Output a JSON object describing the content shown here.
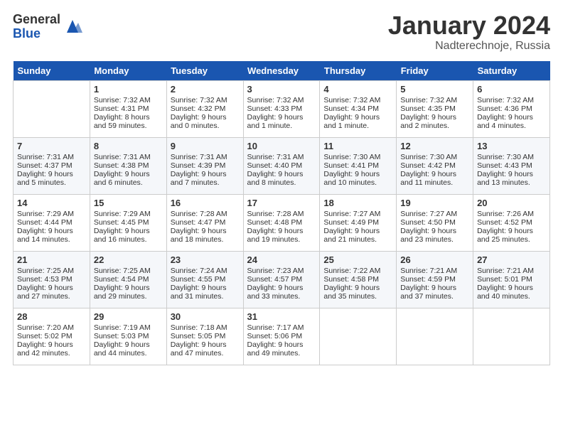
{
  "logo": {
    "general": "General",
    "blue": "Blue"
  },
  "title": "January 2024",
  "subtitle": "Nadterechnoje, Russia",
  "days_of_week": [
    "Sunday",
    "Monday",
    "Tuesday",
    "Wednesday",
    "Thursday",
    "Friday",
    "Saturday"
  ],
  "weeks": [
    [
      {
        "day": "",
        "sunrise": "",
        "sunset": "",
        "daylight": ""
      },
      {
        "day": "1",
        "sunrise": "Sunrise: 7:32 AM",
        "sunset": "Sunset: 4:31 PM",
        "daylight": "Daylight: 8 hours and 59 minutes."
      },
      {
        "day": "2",
        "sunrise": "Sunrise: 7:32 AM",
        "sunset": "Sunset: 4:32 PM",
        "daylight": "Daylight: 9 hours and 0 minutes."
      },
      {
        "day": "3",
        "sunrise": "Sunrise: 7:32 AM",
        "sunset": "Sunset: 4:33 PM",
        "daylight": "Daylight: 9 hours and 1 minute."
      },
      {
        "day": "4",
        "sunrise": "Sunrise: 7:32 AM",
        "sunset": "Sunset: 4:34 PM",
        "daylight": "Daylight: 9 hours and 1 minute."
      },
      {
        "day": "5",
        "sunrise": "Sunrise: 7:32 AM",
        "sunset": "Sunset: 4:35 PM",
        "daylight": "Daylight: 9 hours and 2 minutes."
      },
      {
        "day": "6",
        "sunrise": "Sunrise: 7:32 AM",
        "sunset": "Sunset: 4:36 PM",
        "daylight": "Daylight: 9 hours and 4 minutes."
      }
    ],
    [
      {
        "day": "7",
        "sunrise": "Sunrise: 7:31 AM",
        "sunset": "Sunset: 4:37 PM",
        "daylight": "Daylight: 9 hours and 5 minutes."
      },
      {
        "day": "8",
        "sunrise": "Sunrise: 7:31 AM",
        "sunset": "Sunset: 4:38 PM",
        "daylight": "Daylight: 9 hours and 6 minutes."
      },
      {
        "day": "9",
        "sunrise": "Sunrise: 7:31 AM",
        "sunset": "Sunset: 4:39 PM",
        "daylight": "Daylight: 9 hours and 7 minutes."
      },
      {
        "day": "10",
        "sunrise": "Sunrise: 7:31 AM",
        "sunset": "Sunset: 4:40 PM",
        "daylight": "Daylight: 9 hours and 8 minutes."
      },
      {
        "day": "11",
        "sunrise": "Sunrise: 7:30 AM",
        "sunset": "Sunset: 4:41 PM",
        "daylight": "Daylight: 9 hours and 10 minutes."
      },
      {
        "day": "12",
        "sunrise": "Sunrise: 7:30 AM",
        "sunset": "Sunset: 4:42 PM",
        "daylight": "Daylight: 9 hours and 11 minutes."
      },
      {
        "day": "13",
        "sunrise": "Sunrise: 7:30 AM",
        "sunset": "Sunset: 4:43 PM",
        "daylight": "Daylight: 9 hours and 13 minutes."
      }
    ],
    [
      {
        "day": "14",
        "sunrise": "Sunrise: 7:29 AM",
        "sunset": "Sunset: 4:44 PM",
        "daylight": "Daylight: 9 hours and 14 minutes."
      },
      {
        "day": "15",
        "sunrise": "Sunrise: 7:29 AM",
        "sunset": "Sunset: 4:45 PM",
        "daylight": "Daylight: 9 hours and 16 minutes."
      },
      {
        "day": "16",
        "sunrise": "Sunrise: 7:28 AM",
        "sunset": "Sunset: 4:47 PM",
        "daylight": "Daylight: 9 hours and 18 minutes."
      },
      {
        "day": "17",
        "sunrise": "Sunrise: 7:28 AM",
        "sunset": "Sunset: 4:48 PM",
        "daylight": "Daylight: 9 hours and 19 minutes."
      },
      {
        "day": "18",
        "sunrise": "Sunrise: 7:27 AM",
        "sunset": "Sunset: 4:49 PM",
        "daylight": "Daylight: 9 hours and 21 minutes."
      },
      {
        "day": "19",
        "sunrise": "Sunrise: 7:27 AM",
        "sunset": "Sunset: 4:50 PM",
        "daylight": "Daylight: 9 hours and 23 minutes."
      },
      {
        "day": "20",
        "sunrise": "Sunrise: 7:26 AM",
        "sunset": "Sunset: 4:52 PM",
        "daylight": "Daylight: 9 hours and 25 minutes."
      }
    ],
    [
      {
        "day": "21",
        "sunrise": "Sunrise: 7:25 AM",
        "sunset": "Sunset: 4:53 PM",
        "daylight": "Daylight: 9 hours and 27 minutes."
      },
      {
        "day": "22",
        "sunrise": "Sunrise: 7:25 AM",
        "sunset": "Sunset: 4:54 PM",
        "daylight": "Daylight: 9 hours and 29 minutes."
      },
      {
        "day": "23",
        "sunrise": "Sunrise: 7:24 AM",
        "sunset": "Sunset: 4:55 PM",
        "daylight": "Daylight: 9 hours and 31 minutes."
      },
      {
        "day": "24",
        "sunrise": "Sunrise: 7:23 AM",
        "sunset": "Sunset: 4:57 PM",
        "daylight": "Daylight: 9 hours and 33 minutes."
      },
      {
        "day": "25",
        "sunrise": "Sunrise: 7:22 AM",
        "sunset": "Sunset: 4:58 PM",
        "daylight": "Daylight: 9 hours and 35 minutes."
      },
      {
        "day": "26",
        "sunrise": "Sunrise: 7:21 AM",
        "sunset": "Sunset: 4:59 PM",
        "daylight": "Daylight: 9 hours and 37 minutes."
      },
      {
        "day": "27",
        "sunrise": "Sunrise: 7:21 AM",
        "sunset": "Sunset: 5:01 PM",
        "daylight": "Daylight: 9 hours and 40 minutes."
      }
    ],
    [
      {
        "day": "28",
        "sunrise": "Sunrise: 7:20 AM",
        "sunset": "Sunset: 5:02 PM",
        "daylight": "Daylight: 9 hours and 42 minutes."
      },
      {
        "day": "29",
        "sunrise": "Sunrise: 7:19 AM",
        "sunset": "Sunset: 5:03 PM",
        "daylight": "Daylight: 9 hours and 44 minutes."
      },
      {
        "day": "30",
        "sunrise": "Sunrise: 7:18 AM",
        "sunset": "Sunset: 5:05 PM",
        "daylight": "Daylight: 9 hours and 47 minutes."
      },
      {
        "day": "31",
        "sunrise": "Sunrise: 7:17 AM",
        "sunset": "Sunset: 5:06 PM",
        "daylight": "Daylight: 9 hours and 49 minutes."
      },
      {
        "day": "",
        "sunrise": "",
        "sunset": "",
        "daylight": ""
      },
      {
        "day": "",
        "sunrise": "",
        "sunset": "",
        "daylight": ""
      },
      {
        "day": "",
        "sunrise": "",
        "sunset": "",
        "daylight": ""
      }
    ]
  ]
}
